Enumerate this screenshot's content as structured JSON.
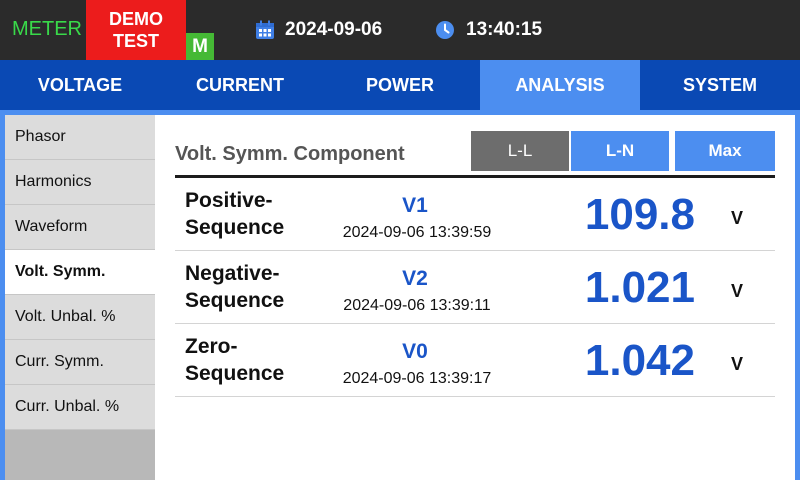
{
  "status_bar": {
    "meter_label": "METER",
    "demo_label": "DEMO TEST",
    "mode_badge": "M",
    "calendar_icon": "calendar-icon",
    "date": "2024-09-06",
    "clock_icon": "clock-icon",
    "time": "13:40:15",
    "colors": {
      "meter": "#39d94a",
      "demo_bg": "#ec1c1c",
      "mode_bg": "#45b935"
    }
  },
  "tabs": [
    {
      "label": "VOLTAGE",
      "active": false
    },
    {
      "label": "CURRENT",
      "active": false
    },
    {
      "label": "POWER",
      "active": false
    },
    {
      "label": "ANALYSIS",
      "active": true
    },
    {
      "label": "SYSTEM",
      "active": false
    }
  ],
  "sidebar": {
    "items": [
      {
        "label": "Phasor",
        "active": false
      },
      {
        "label": "Harmonics",
        "active": false
      },
      {
        "label": "Waveform",
        "active": false
      },
      {
        "label": "Volt. Symm.",
        "active": true
      },
      {
        "label": "Volt. Unbal. %",
        "active": false
      },
      {
        "label": "Curr. Symm.",
        "active": false
      },
      {
        "label": "Curr. Unbal. %",
        "active": false
      }
    ]
  },
  "panel": {
    "title": "Volt. Symm. Component",
    "buttons": {
      "ll": "L-L",
      "ln": "L-N",
      "max": "Max"
    },
    "rows": [
      {
        "name_line1": "Positive-",
        "name_line2": "Sequence",
        "symbol": "V1",
        "timestamp": "2024-09-06 13:39:59",
        "value": "109.8",
        "unit": "V"
      },
      {
        "name_line1": "Negative-",
        "name_line2": "Sequence",
        "symbol": "V2",
        "timestamp": "2024-09-06 13:39:11",
        "value": "1.021",
        "unit": "V"
      },
      {
        "name_line1": "Zero-",
        "name_line2": "Sequence",
        "symbol": "V0",
        "timestamp": "2024-09-06 13:39:17",
        "value": "1.042",
        "unit": "V"
      }
    ]
  },
  "theme": {
    "accent": "#4c8ef0",
    "nav": "#0a49b4",
    "value_color": "#1a55c8"
  }
}
